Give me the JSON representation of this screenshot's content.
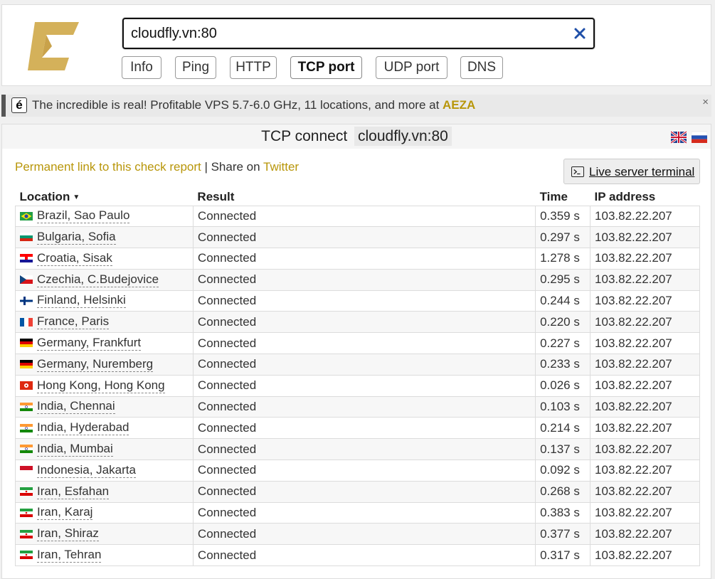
{
  "search": {
    "value": "cloudfly.vn:80"
  },
  "tabs": [
    {
      "label": "Info"
    },
    {
      "label": "Ping"
    },
    {
      "label": "HTTP"
    },
    {
      "label": "TCP port",
      "active": true
    },
    {
      "label": "UDP port"
    },
    {
      "label": "DNS"
    }
  ],
  "banner": {
    "icon_text": "é",
    "text": "The incredible is real! Profitable VPS 5.7-6.0 GHz, 11 locations, and more at ",
    "brand": "AEZA",
    "close": "×"
  },
  "report": {
    "title": "TCP connect",
    "host": "cloudfly.vn:80",
    "permalink": "Permanent link to this check report",
    "separator": " | Share on ",
    "twitter": "Twitter",
    "terminal_button": "Live server terminal"
  },
  "table": {
    "headers": {
      "location": "Location",
      "result": "Result",
      "time": "Time",
      "ip": "IP address"
    },
    "rows": [
      {
        "flag": "br",
        "location": "Brazil, Sao Paulo",
        "result": "Connected",
        "time": "0.359 s",
        "ip": "103.82.22.207"
      },
      {
        "flag": "bg",
        "location": "Bulgaria, Sofia",
        "result": "Connected",
        "time": "0.297 s",
        "ip": "103.82.22.207"
      },
      {
        "flag": "hr",
        "location": "Croatia, Sisak",
        "result": "Connected",
        "time": "1.278 s",
        "ip": "103.82.22.207"
      },
      {
        "flag": "cz",
        "location": "Czechia, C.Budejovice",
        "result": "Connected",
        "time": "0.295 s",
        "ip": "103.82.22.207"
      },
      {
        "flag": "fi",
        "location": "Finland, Helsinki",
        "result": "Connected",
        "time": "0.244 s",
        "ip": "103.82.22.207"
      },
      {
        "flag": "fr",
        "location": "France, Paris",
        "result": "Connected",
        "time": "0.220 s",
        "ip": "103.82.22.207"
      },
      {
        "flag": "de",
        "location": "Germany, Frankfurt",
        "result": "Connected",
        "time": "0.227 s",
        "ip": "103.82.22.207"
      },
      {
        "flag": "de",
        "location": "Germany, Nuremberg",
        "result": "Connected",
        "time": "0.233 s",
        "ip": "103.82.22.207"
      },
      {
        "flag": "hk",
        "location": "Hong Kong, Hong Kong",
        "result": "Connected",
        "time": "0.026 s",
        "ip": "103.82.22.207"
      },
      {
        "flag": "in",
        "location": "India, Chennai",
        "result": "Connected",
        "time": "0.103 s",
        "ip": "103.82.22.207"
      },
      {
        "flag": "in",
        "location": "India, Hyderabad",
        "result": "Connected",
        "time": "0.214 s",
        "ip": "103.82.22.207"
      },
      {
        "flag": "in",
        "location": "India, Mumbai",
        "result": "Connected",
        "time": "0.137 s",
        "ip": "103.82.22.207"
      },
      {
        "flag": "id",
        "location": "Indonesia, Jakarta",
        "result": "Connected",
        "time": "0.092 s",
        "ip": "103.82.22.207"
      },
      {
        "flag": "ir",
        "location": "Iran, Esfahan",
        "result": "Connected",
        "time": "0.268 s",
        "ip": "103.82.22.207"
      },
      {
        "flag": "ir",
        "location": "Iran, Karaj",
        "result": "Connected",
        "time": "0.383 s",
        "ip": "103.82.22.207"
      },
      {
        "flag": "ir",
        "location": "Iran, Shiraz",
        "result": "Connected",
        "time": "0.377 s",
        "ip": "103.82.22.207"
      },
      {
        "flag": "ir",
        "location": "Iran, Tehran",
        "result": "Connected",
        "time": "0.317 s",
        "ip": "103.82.22.207"
      }
    ]
  },
  "colors": {
    "accent": "#b8960a",
    "logo": "#d4b15a"
  }
}
